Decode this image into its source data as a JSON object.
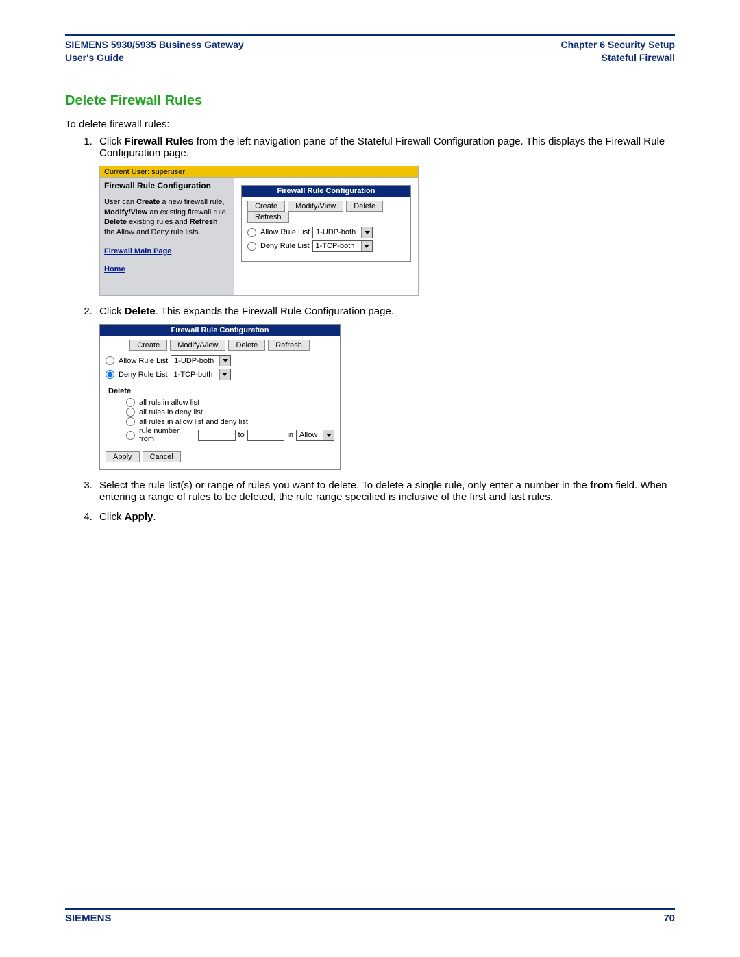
{
  "header": {
    "product": "SIEMENS 5930/5935 Business Gateway",
    "guide": "User's Guide",
    "chapter": "Chapter 6  Security Setup",
    "subsection": "Stateful Firewall"
  },
  "section_title": "Delete Firewall Rules",
  "intro": "To delete firewall rules:",
  "steps": {
    "s1a": "Click ",
    "s1b": "Firewall Rules",
    "s1c": " from the left navigation pane of the Stateful Firewall Configuration page. This displays the Firewall Rule Configuration page.",
    "s2a": "Click ",
    "s2b": "Delete",
    "s2c": ". This expands the Firewall Rule Configuration page.",
    "s3a": "Select the rule list(s) or range of rules you want to delete. To delete a single rule, only enter a number in the ",
    "s3b": "from",
    "s3c": " field. When entering a range of rules to be deleted, the rule range specified is inclusive of the first and last rules.",
    "s4a": "Click ",
    "s4b": "Apply",
    "s4c": "."
  },
  "shot1": {
    "current_user": "Current User: superuser",
    "side_title": "Firewall Rule Configuration",
    "side_desc_1": "User can ",
    "side_desc_2": "Create",
    "side_desc_3": " a new firewall rule, ",
    "side_desc_4": "Modify/View",
    "side_desc_5": " an existing firewall rule, ",
    "side_desc_6": "Delete",
    "side_desc_7": " existing rules and ",
    "side_desc_8": "Refresh",
    "side_desc_9": " the Allow and Deny rule lists.",
    "link_main": "Firewall Main Page",
    "link_home": "Home",
    "panel_title": "Firewall Rule Configuration",
    "btn_create": "Create",
    "btn_modify": "Modify/View",
    "btn_delete": "Delete",
    "btn_refresh": "Refresh",
    "allow_label": "Allow Rule List",
    "allow_value": "1-UDP-both",
    "deny_label": "Deny Rule List",
    "deny_value": "1-TCP-both"
  },
  "shot2": {
    "panel_title": "Firewall Rule Configuration",
    "btn_create": "Create",
    "btn_modify": "Modify/View",
    "btn_delete": "Delete",
    "btn_refresh": "Refresh",
    "allow_label": "Allow Rule List",
    "allow_value": "1-UDP-both",
    "deny_label": "Deny Rule List",
    "deny_value": "1-TCP-both",
    "delete_heading": "Delete",
    "opt1": "all ruls in allow list",
    "opt2": "all rules in deny list",
    "opt3": "all rules in allow list and deny list",
    "opt4_a": "rule number from",
    "opt4_to": "to",
    "opt4_in": "in",
    "opt4_sel": "Allow",
    "btn_apply": "Apply",
    "btn_cancel": "Cancel"
  },
  "footer": {
    "brand": "SIEMENS",
    "page_no": "70"
  }
}
